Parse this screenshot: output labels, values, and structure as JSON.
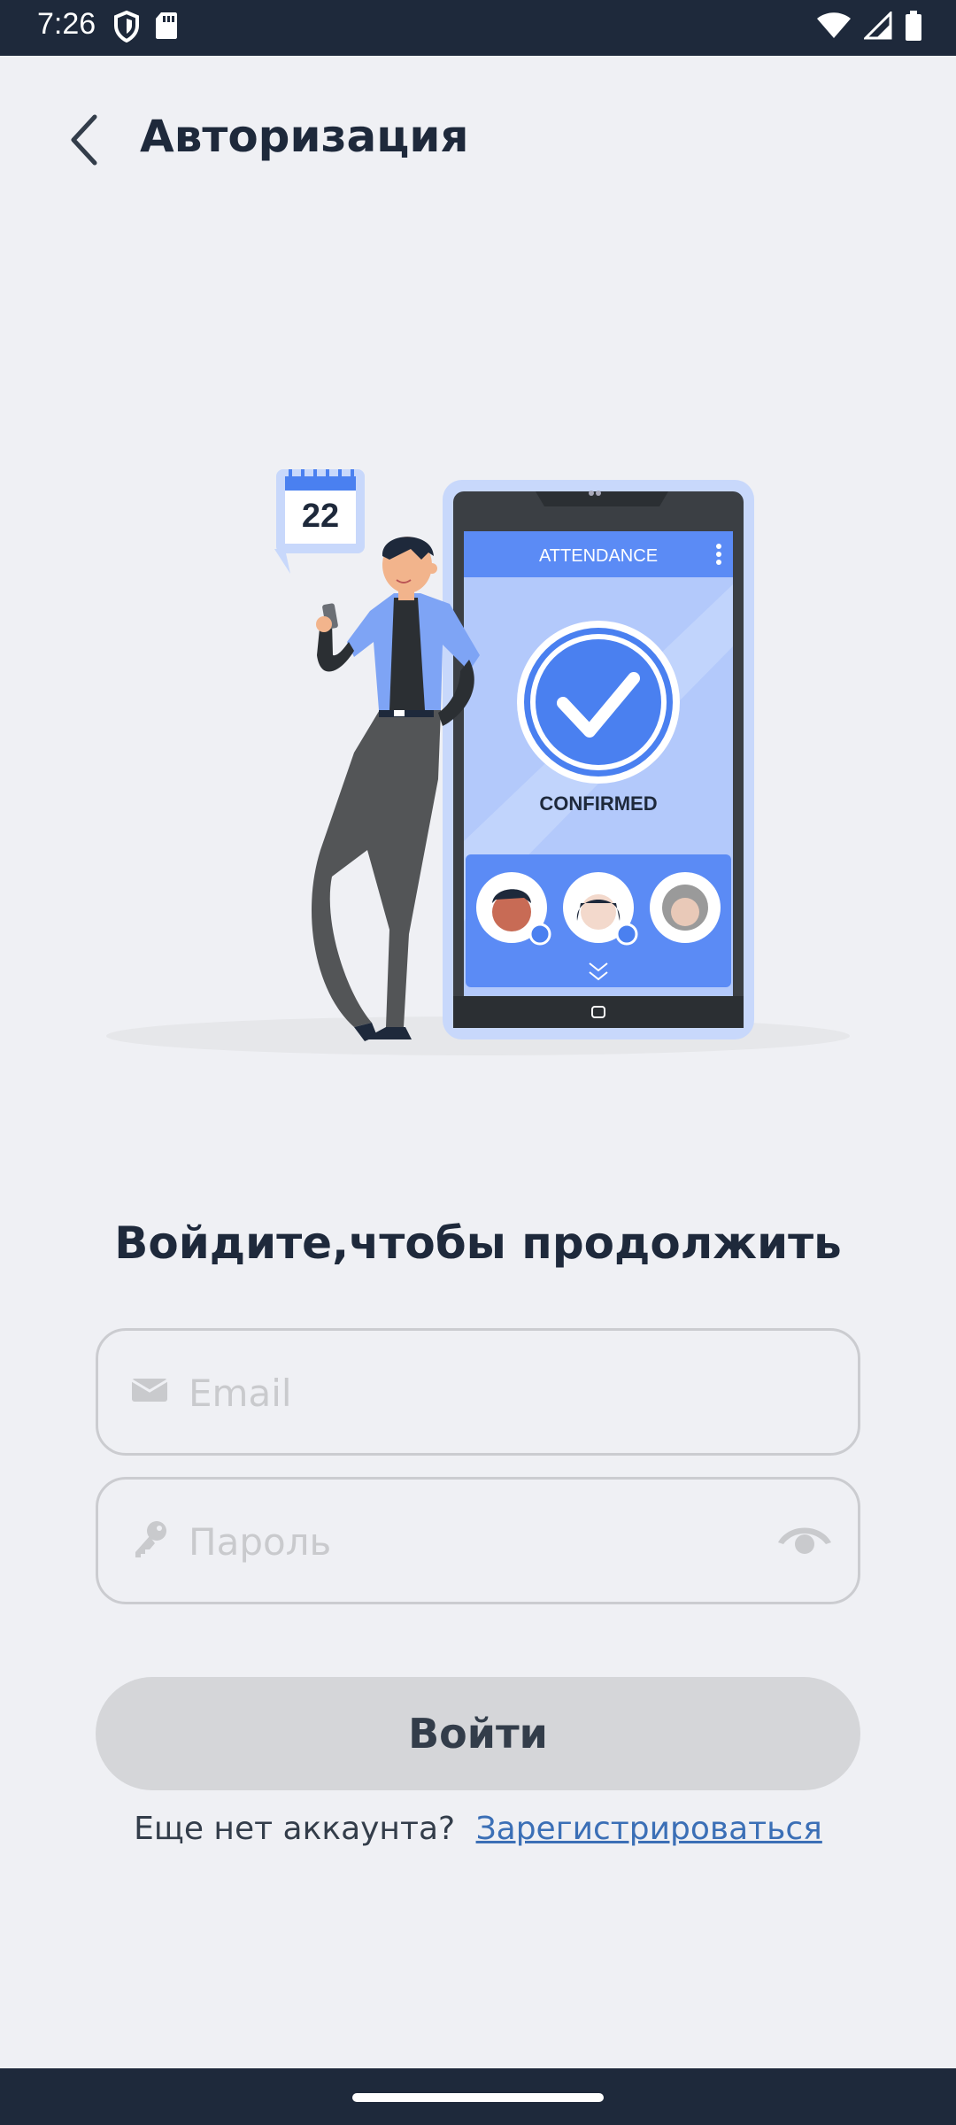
{
  "status_bar": {
    "time": "7:26"
  },
  "header": {
    "title": "Авторизация"
  },
  "illustration": {
    "calendar_day": "22",
    "app_header": "ATTENDANCE",
    "confirmed_label": "CONFIRMED"
  },
  "form": {
    "heading": "Войдите,чтобы продолжить",
    "email_placeholder": "Email",
    "password_placeholder": "Пароль",
    "submit_label": "Войти"
  },
  "signup": {
    "prompt": "Еще нет аккаунта?",
    "link": "Зарегистрироваться"
  },
  "colors": {
    "background": "#eff0f4",
    "dark": "#1e293b",
    "accent": "#4a80f0",
    "link": "#3b6fb6"
  }
}
